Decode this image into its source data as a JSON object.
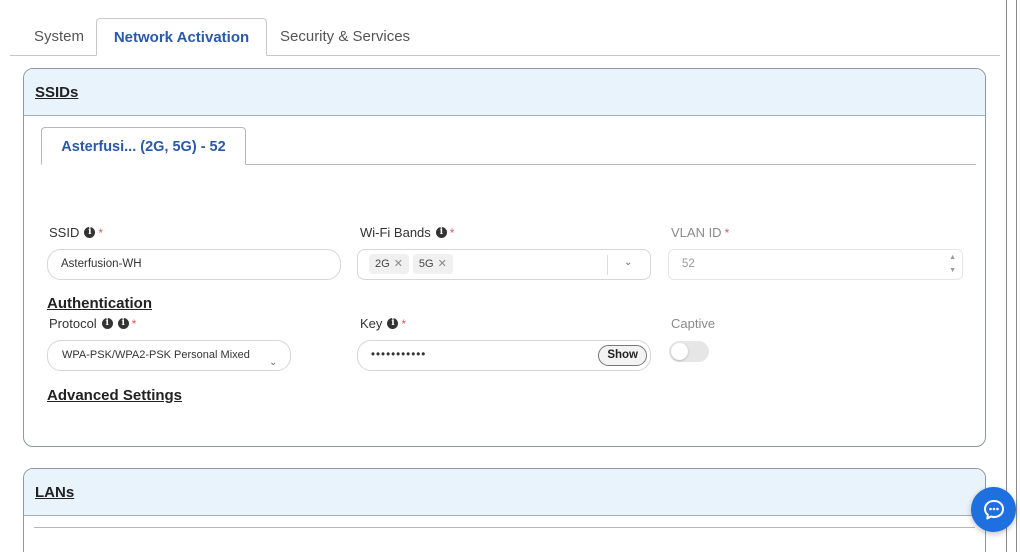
{
  "tabs": [
    {
      "label": "System"
    },
    {
      "label": "Network Activation"
    },
    {
      "label": "Security & Services"
    }
  ],
  "ssids": {
    "title": "SSIDs",
    "subtab": "Asterfusi... (2G, 5G) - 52",
    "ssid_label": "SSID",
    "ssid_value": "Asterfusion-WH",
    "bands_label": "Wi-Fi Bands",
    "bands": [
      "2G",
      "5G"
    ],
    "vlan_label": "VLAN ID",
    "vlan_value": "52",
    "auth_title": "Authentication",
    "protocol_label": "Protocol",
    "protocol_value": "WPA-PSK/WPA2-PSK Personal Mixed",
    "key_label": "Key",
    "key_value": "•••••••••••",
    "show_label": "Show",
    "captive_label": "Captive",
    "captive_on": false,
    "advanced_title": "Advanced Settings"
  },
  "lans": {
    "title": "LANs"
  },
  "required_mark": "*",
  "info_glyph": "i",
  "icons": {
    "info": "info-circle-icon",
    "chevron": "chevron-down-icon",
    "chat": "chat-bubble-icon"
  },
  "colors": {
    "accent": "#2a5aa6",
    "header_bg": "#e8f3fb",
    "chat_button": "#1e6fe0",
    "required": "#e05a5a"
  }
}
